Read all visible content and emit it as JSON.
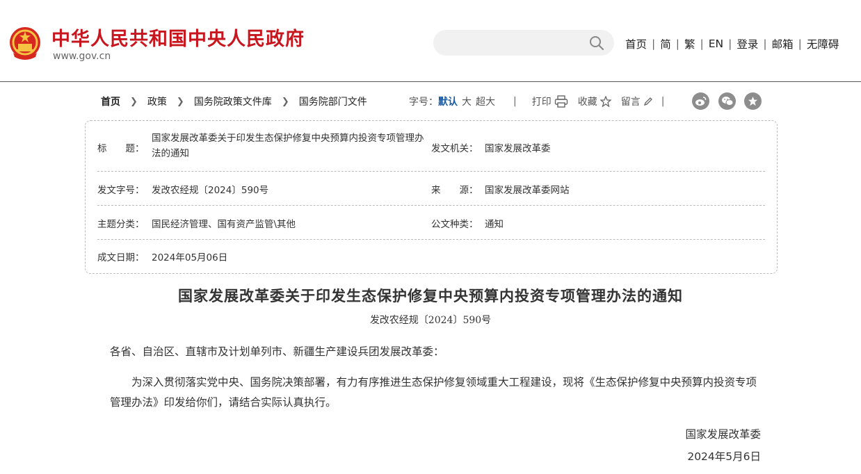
{
  "header": {
    "site_title": "中华人民共和国中央人民政府",
    "site_url": "www.gov.cn",
    "search_placeholder": "",
    "nav": [
      {
        "label": "首页"
      },
      {
        "label": "简"
      },
      {
        "label": "繁"
      },
      {
        "label": "EN"
      },
      {
        "label": "登录"
      },
      {
        "label": "邮箱"
      },
      {
        "label": "无障碍"
      }
    ]
  },
  "breadcrumb": [
    "首页",
    "政策",
    "国务院政策文件库",
    "国务院部门文件"
  ],
  "tools": {
    "font_size_label": "字号：",
    "font_sizes": [
      "默认",
      "大",
      "超大"
    ],
    "separator": "|",
    "print": "打印",
    "favorite": "收藏",
    "comment": "留言"
  },
  "info": {
    "title_label": "标　　题：",
    "title_value": "国家发展改革委关于印发生态保护修复中央预算内投资专项管理办法的通知",
    "issuer_label": "发文机关：",
    "issuer_value": "国家发展改革委",
    "doc_no_label": "发文字号：",
    "doc_no_value": "发改农经规〔2024〕590号",
    "source_label": "来　　源：",
    "source_value": "国家发展改革委网站",
    "topic_label": "主题分类：",
    "topic_value": "国民经济管理、国有资产监管\\其他",
    "type_label": "公文种类：",
    "type_value": "通知",
    "date_label": "成文日期：",
    "date_value": "2024年05月06日"
  },
  "document": {
    "title": "国家发展改革委关于印发生态保护修复中央预算内投资专项管理办法的通知",
    "number": "发改农经规〔2024〕590号",
    "addressee": "各省、自治区、直辖市及计划单列市、新疆生产建设兵团发展改革委：",
    "paragraph": "为深入贯彻落实党中央、国务院决策部署，有力有序推进生态保护修复领域重大工程建设，现将《生态保护修复中央预算内投资专项管理办法》印发给你们，请结合实际认真执行。",
    "signature_org": "国家发展改革委",
    "signature_date": "2024年5月6日"
  },
  "colors": {
    "brand_red": "#c8161e",
    "active_blue": "#1a5aa6",
    "share_gray": "#8d8d8d"
  },
  "icons": [
    "national-emblem-icon",
    "search-icon",
    "printer-icon",
    "star-icon",
    "pencil-icon",
    "weibo-icon",
    "wechat-icon",
    "favorite-share-icon"
  ]
}
